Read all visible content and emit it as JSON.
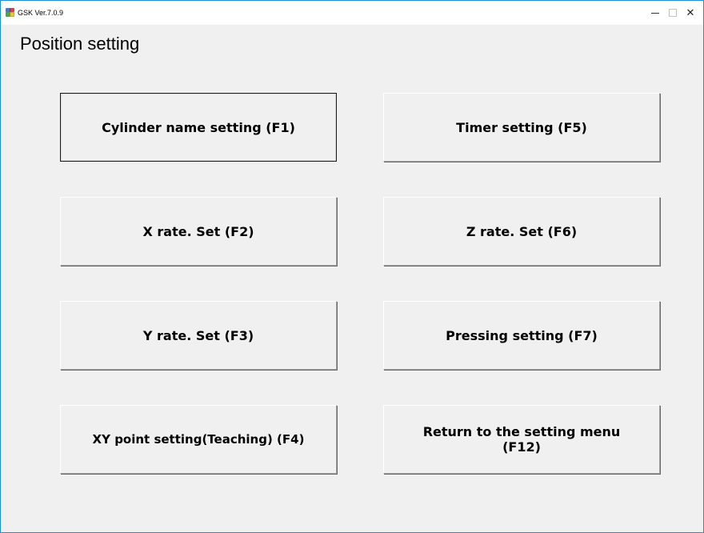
{
  "window": {
    "title": "GSK Ver.7.0.9",
    "controls": {
      "minimize": "minimize",
      "maximize": "maximize",
      "close": "✕"
    }
  },
  "page": {
    "title": "Position setting"
  },
  "buttons": {
    "cylinder_name": "Cylinder name setting (F1)",
    "timer": "Timer setting (F5)",
    "x_rate": "X rate. Set (F2)",
    "z_rate": "Z rate. Set (F6)",
    "y_rate": "Y rate. Set (F3)",
    "pressing": "Pressing setting (F7)",
    "xy_point": "XY point setting(Teaching) (F4)",
    "return_line1": "Return to the setting menu",
    "return_line2": "(F12)"
  },
  "colors": {
    "window_border": "#1e90d8",
    "client_background": "#f0f0f0",
    "titlebar_background": "#ffffff"
  },
  "icons": {
    "app": "app-window-icon",
    "minimize": "minimize-icon",
    "maximize": "maximize-icon",
    "close": "close-icon"
  }
}
